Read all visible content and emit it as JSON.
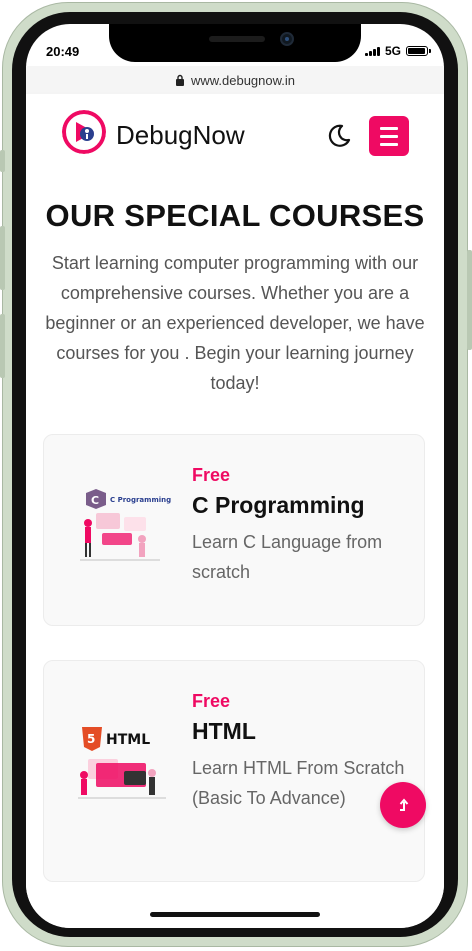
{
  "status_bar": {
    "time": "20:49",
    "network": "5G"
  },
  "browser": {
    "url": "www.debugnow.in"
  },
  "header": {
    "brand": "DebugNow"
  },
  "colors": {
    "accent": "#ef0a63",
    "title": "#111111",
    "muted": "#666666"
  },
  "section": {
    "title": "OUR SPECIAL COURSES",
    "description": "Start learning computer programming with our comprehensive courses. Whether you are a beginner or an experienced developer, we have courses for you . Begin your learning journey today!"
  },
  "courses": [
    {
      "price": "Free",
      "title": "C Programming",
      "description": "Learn C Language from scratch",
      "image_label": "C Programming",
      "icon": "c-programming-illustration-icon"
    },
    {
      "price": "Free",
      "title": "HTML",
      "description": "Learn HTML From Scratch (Basic To Advance)",
      "image_label": "HTML",
      "image_badge": "5",
      "icon": "html-illustration-icon"
    }
  ],
  "icons": {
    "menu": "hamburger-menu-icon",
    "theme": "moon-icon",
    "scroll_top": "arrow-up-icon",
    "lock": "lock-icon"
  }
}
